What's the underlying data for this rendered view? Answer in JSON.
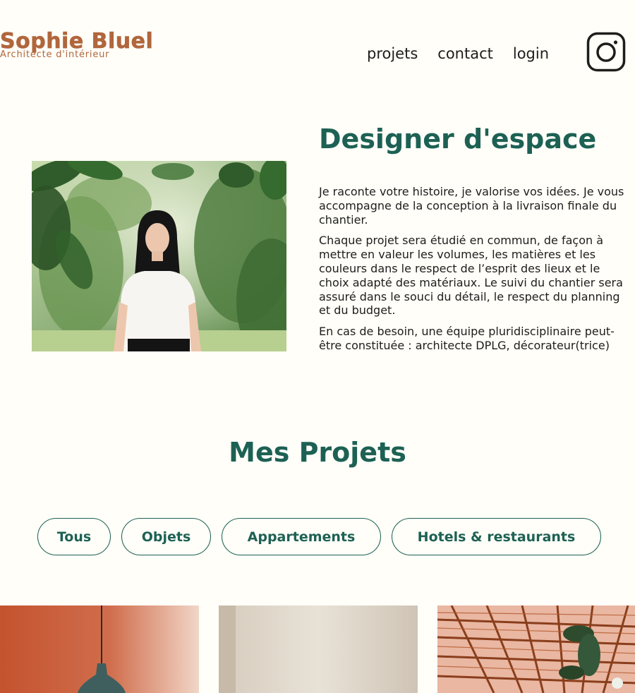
{
  "header": {
    "brand_name": "Sophie Bluel",
    "brand_subtitle": "Architecte d'intérieur",
    "nav": [
      {
        "label": "projets"
      },
      {
        "label": "contact"
      },
      {
        "label": "login"
      }
    ],
    "social_icon": "instagram-icon"
  },
  "introduction": {
    "title": "Designer d'espace",
    "paragraphs": [
      "Je raconte votre histoire, je valorise vos idées. Je vous accompagne de la conception à la livraison finale du chantier.",
      "Chaque projet sera étudié en commun, de façon à mettre en valeur les volumes, les matières et les couleurs dans le respect de l’esprit des lieux et le choix adapté des matériaux. Le suivi du chantier sera assuré dans le souci du détail, le respect du planning et du budget.",
      "En cas de besoin, une équipe pluridisciplinaire peut-être constituée : architecte DPLG, décorateur(trice)"
    ]
  },
  "portfolio": {
    "title": "Mes Projets",
    "filters": [
      {
        "label": "Tous"
      },
      {
        "label": "Objets"
      },
      {
        "label": "Appartements"
      },
      {
        "label": "Hotels & restaurants"
      }
    ]
  },
  "colors": {
    "background": "#FFFEF8",
    "brand": "#B1663C",
    "accent": "#1D6154",
    "text": "#1d1d1b"
  }
}
